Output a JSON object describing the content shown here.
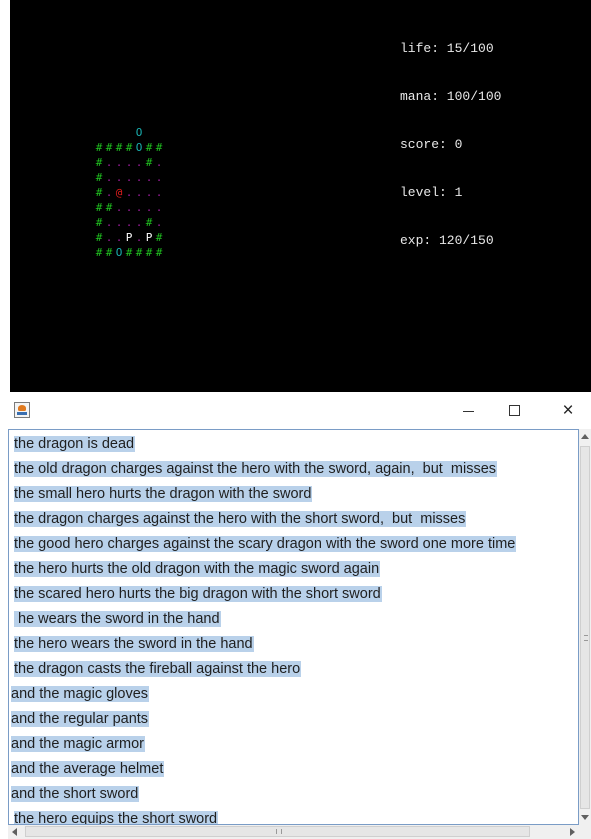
{
  "stats": [
    "life: 15/100",
    "mana: 100/100",
    "score: 0",
    "level: 1",
    "exp: 120/150"
  ],
  "map": {
    "colors": {
      "wall": "#1fbf1f",
      "floor": "#a01ea0",
      "door": "#19b0b0",
      "hero": "#e01d1d",
      "enemy": "#ffffff"
    },
    "rows": [
      "    O    ",
      "####O##  ",
      "#....#.  ",
      "#......  ",
      "#.@....  ",
      "##.....  ",
      "#....#.  ",
      "#..P.P#  ",
      "##O####  "
    ]
  },
  "window": {
    "icon": "java-cup-icon",
    "close_label": "×"
  },
  "log": [
    "the dragon is dead",
    "the old dragon charges against the hero with the sword, again,  but  misses",
    "the small hero hurts the dragon with the sword",
    "the dragon charges against the hero with the short sword,  but  misses",
    "the good hero charges against the scary dragon with the sword one more time",
    "the hero hurts the old dragon with the magic sword again",
    "the scared hero hurts the big dragon with the short sword",
    " he wears the sword in the hand",
    "the hero wears the sword in the hand",
    "the dragon casts the fireball against the hero",
    "and the magic gloves",
    "and the regular pants",
    "and the magic armor",
    "and the average helmet",
    "and the short sword",
    "the hero equips the short sword"
  ],
  "log_indent": [
    5,
    5,
    5,
    5,
    5,
    5,
    5,
    5,
    5,
    5,
    2,
    2,
    2,
    2,
    2,
    5
  ]
}
